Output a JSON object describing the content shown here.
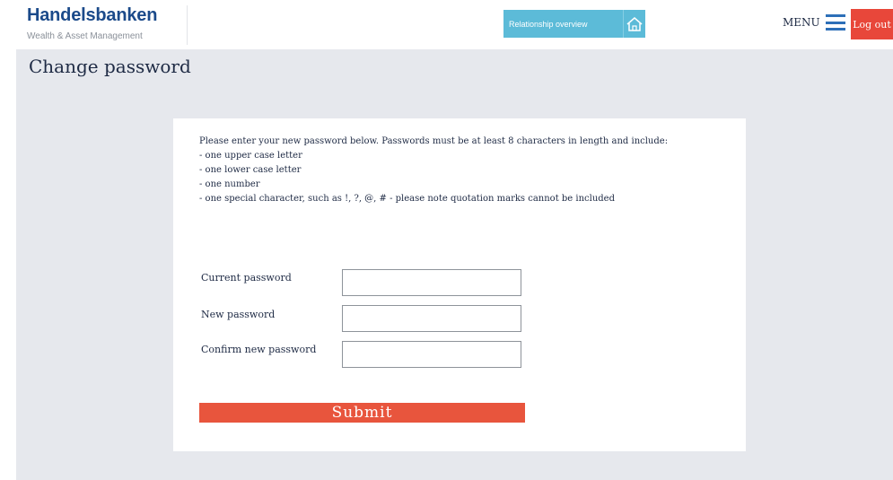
{
  "header": {
    "logo_name": "Handelsbanken",
    "logo_subtitle": "Wealth & Asset Management",
    "relationship_button": "Relationship overview",
    "relationship_icon": "house-icon",
    "menu_label": "MENU",
    "menu_icon": "hamburger-icon",
    "logout_label": "Log out"
  },
  "page": {
    "title": "Change password"
  },
  "form": {
    "instructions": {
      "intro": "Please enter your new password below. Passwords must be at least 8 characters in length and include:",
      "rules": [
        "- one upper case letter",
        "- one lower case letter",
        "- one number",
        "- one special character, such as !, ?, @, # - please note quotation marks cannot be included"
      ]
    },
    "fields": [
      {
        "label": "Current password",
        "value": ""
      },
      {
        "label": "New password",
        "value": ""
      },
      {
        "label": "Confirm new password",
        "value": ""
      }
    ],
    "submit_label": "Submit"
  },
  "colors": {
    "brand_blue": "#1b4a8a",
    "relationship_button": "#5cbbd8",
    "logout_red": "#e8473a",
    "submit_orange": "#e8553d",
    "page_background": "#e6e8ed"
  }
}
